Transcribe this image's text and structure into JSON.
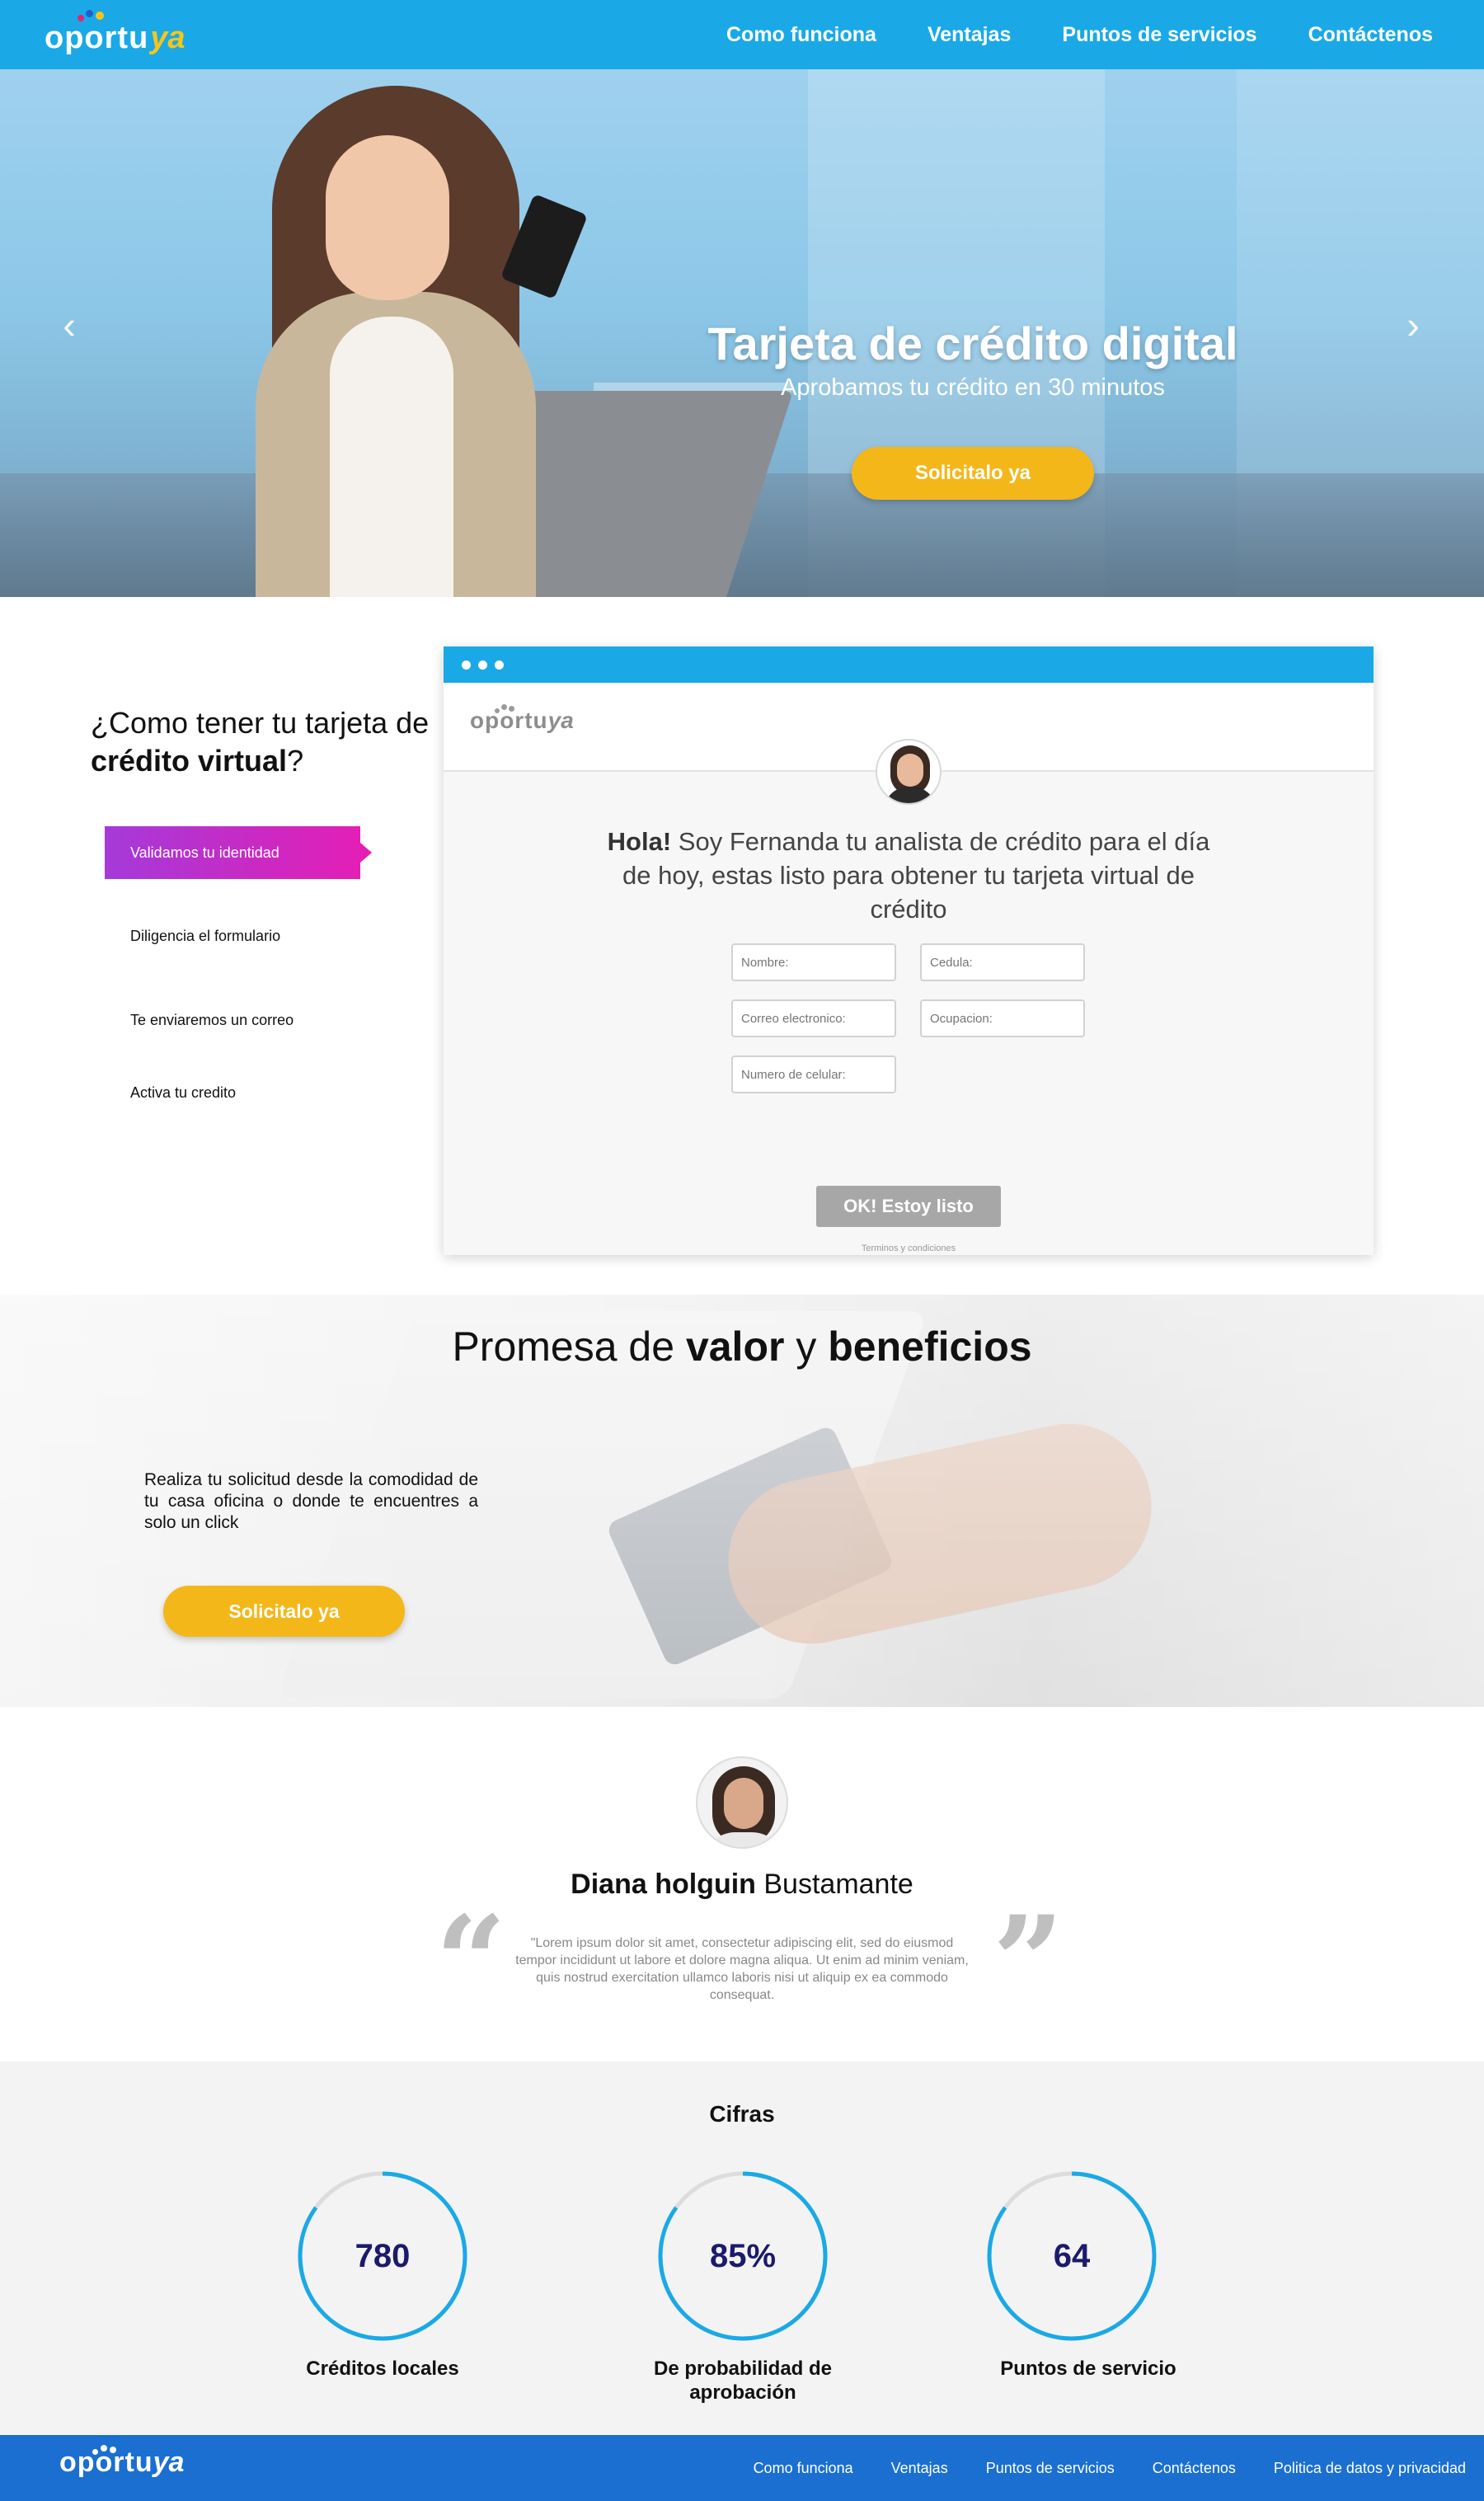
{
  "brand": {
    "logo_text": "oportu",
    "logo_accent": "ya",
    "colors": {
      "primary": "#1aa9e6",
      "accent": "#f4b71a",
      "footer": "#1a6fd0",
      "step_active": "#e31fb5"
    }
  },
  "nav": {
    "items": [
      "Como funciona",
      "Ventajas",
      "Puntos de servicios",
      "Contáctenos"
    ]
  },
  "hero": {
    "title": "Tarjeta de crédito digital",
    "subtitle": "Aprobamos tu crédito en 30 minutos",
    "cta": "Solicitalo ya",
    "prev_icon": "chevron-left-icon",
    "next_icon": "chevron-right-icon"
  },
  "how": {
    "title_part1": "¿Como tener tu tarjeta de ",
    "title_bold": "crédito virtual",
    "title_part2": "?",
    "steps": [
      {
        "label": "Validamos tu identidad",
        "active": true
      },
      {
        "label": "Diligencia el formulario",
        "active": false
      },
      {
        "label": "Te enviaremos un correo",
        "active": false
      },
      {
        "label": "Activa tu credito",
        "active": false
      }
    ],
    "form": {
      "greeting_bold": "Hola!",
      "greeting_text": " Soy Fernanda tu analista de crédito para el día de hoy, estas listo para obtener tu tarjeta virtual de crédito",
      "fields": {
        "nombre": "Nombre:",
        "cedula": "Cedula:",
        "correo": "Correo electronico:",
        "ocupacion": "Ocupacion:",
        "celular": "Numero de celular:"
      },
      "submit": "OK! Estoy listo",
      "terms": "Terminos y condiciones"
    }
  },
  "promesa": {
    "title_part1": "Promesa de ",
    "title_bold1": "valor",
    "title_part2": " y ",
    "title_bold2": "beneficios",
    "text": "Realiza tu solicitud desde la comodidad de tu casa oficina o donde te encuentres a solo un click",
    "cta": "Solicitalo ya"
  },
  "testimonial": {
    "name_bold": "Diana holguin",
    "name_rest": " Bustamante",
    "open_quote": "“",
    "close_quote": "”",
    "quote": "\"Lorem ipsum dolor sit amet, consectetur adipiscing elit, sed do eiusmod tempor incididunt ut labore et dolore magna aliqua. Ut enim ad minim veniam, quis nostrud exercitation ullamco laboris nisi ut aliquip ex ea commodo consequat."
  },
  "cifras": {
    "title": "Cifras",
    "stats": [
      {
        "value": "780",
        "label": "Créditos locales",
        "fill": 0.85
      },
      {
        "value": "85%",
        "label": "De probabilidad de aprobación",
        "fill": 0.85
      },
      {
        "value": "64",
        "label": "Puntos de servicio",
        "fill": 0.85
      }
    ]
  },
  "footer": {
    "items": [
      "Como funciona",
      "Ventajas",
      "Puntos de servicios",
      "Contáctenos",
      "Politica de datos y privacidad"
    ]
  }
}
